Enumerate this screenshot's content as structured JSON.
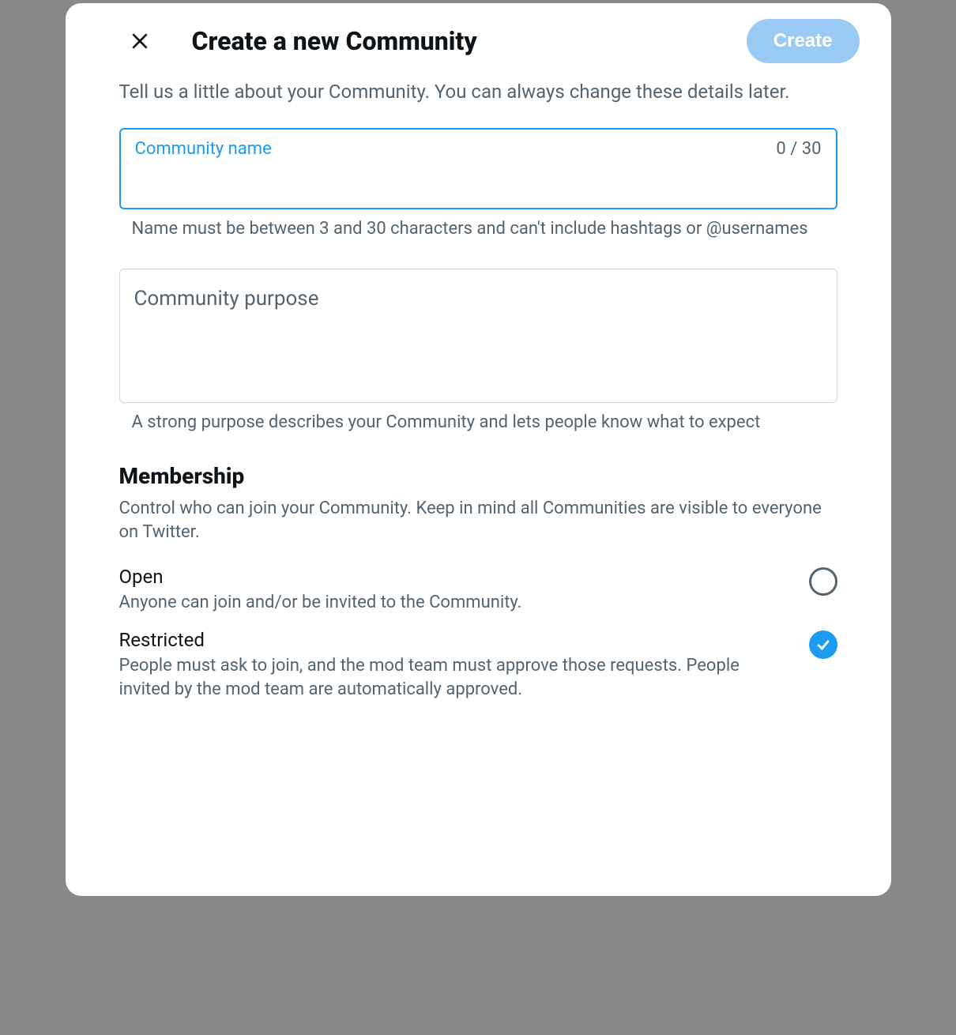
{
  "modal": {
    "title": "Create a new Community",
    "create_label": "Create",
    "intro": "Tell us a little about your Community. You can always change these details later."
  },
  "name_field": {
    "label": "Community name",
    "char_count": "0 / 30",
    "value": "",
    "helper": "Name must be between 3 and 30 characters and can't include hashtags or @usernames"
  },
  "purpose_field": {
    "label": "Community purpose",
    "value": "",
    "helper": "A strong purpose describes your Community and lets people know what to expect"
  },
  "membership": {
    "title": "Membership",
    "desc": "Control who can join your Community. Keep in mind all Communities are visible to everyone on Twitter.",
    "options": [
      {
        "title": "Open",
        "desc": "Anyone can join and/or be invited to the Community.",
        "selected": false
      },
      {
        "title": "Restricted",
        "desc": "People must ask to join, and the mod team must approve those requests. People invited by the mod team are automatically approved.",
        "selected": true
      }
    ]
  }
}
